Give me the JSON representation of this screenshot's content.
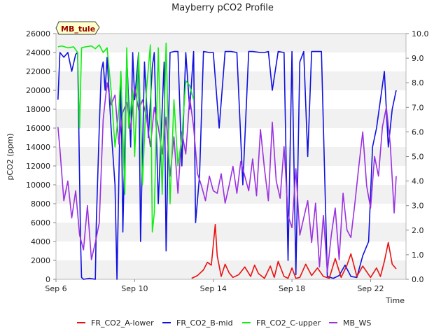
{
  "chart_data": {
    "type": "line",
    "title": "Mayberry pCO2 Profile",
    "xlabel": "Time",
    "ylabel": "pCO2 (ppm)",
    "ylim": [
      0,
      26000
    ],
    "y2lim": [
      0,
      10
    ],
    "xlim": [
      6,
      23.8
    ],
    "x_ticks": [
      6,
      10,
      14,
      18,
      22
    ],
    "x_tick_labels": [
      "Sep 6",
      "Sep 10",
      "Sep 14",
      "Sep 18",
      "Sep 22"
    ],
    "y_ticks": [
      0,
      2000,
      4000,
      6000,
      8000,
      10000,
      12000,
      14000,
      16000,
      18000,
      20000,
      22000,
      24000,
      26000
    ],
    "y2_ticks": [
      "0.0",
      "1.0",
      "2.0",
      "3.0",
      "4.0",
      "5.0",
      "6.0",
      "7.0",
      "8.0",
      "9.0",
      "10.0"
    ],
    "grid": "horizontal bands",
    "legend_position": "bottom",
    "annotation": "MB_tule",
    "series": [
      {
        "name": "FR_CO2_A-lower",
        "color": "#e81010",
        "axis": "left",
        "x": [
          12.9,
          13.2,
          13.5,
          13.7,
          13.9,
          14.1,
          14.2,
          14.4,
          14.6,
          14.8,
          15.0,
          15.3,
          15.6,
          15.9,
          16.1,
          16.3,
          16.6,
          16.9,
          17.1,
          17.3,
          17.6,
          17.8,
          18.0,
          18.2,
          18.4,
          18.7,
          19.0,
          19.3,
          19.6,
          19.9,
          20.2,
          20.5,
          20.8,
          21.0,
          21.3,
          21.6,
          21.8,
          22.0,
          22.3,
          22.5,
          22.7,
          22.9,
          23.1,
          23.3
        ],
        "y": [
          100,
          400,
          1000,
          1800,
          1500,
          5800,
          2500,
          300,
          1600,
          700,
          200,
          500,
          1300,
          300,
          1500,
          600,
          100,
          1400,
          200,
          1900,
          300,
          100,
          1200,
          100,
          200,
          1600,
          400,
          1200,
          300,
          100,
          2200,
          200,
          1500,
          2700,
          300,
          1400,
          800,
          200,
          1200,
          300,
          1900,
          3900,
          1600,
          1100
        ]
      },
      {
        "name": "FR_CO2_B-mid",
        "color": "#1010e0",
        "axis": "left",
        "x": [
          6.1,
          6.2,
          6.4,
          6.6,
          6.8,
          7.0,
          7.1,
          7.25,
          7.3,
          7.4,
          7.7,
          8.0,
          8.05,
          8.2,
          8.3,
          8.4,
          8.5,
          8.6,
          8.8,
          9.0,
          9.1,
          9.3,
          9.4,
          9.6,
          9.8,
          9.9,
          10.0,
          10.2,
          10.3,
          10.5,
          10.7,
          10.9,
          11.0,
          11.2,
          11.5,
          11.6,
          11.8,
          12.0,
          12.2,
          12.4,
          12.6,
          12.8,
          13.0,
          13.1,
          13.3,
          13.5,
          13.8,
          14.0,
          14.3,
          14.6,
          14.9,
          15.2,
          15.5,
          15.8,
          16.0,
          16.4,
          16.6,
          16.8,
          17.0,
          17.3,
          17.6,
          17.8,
          18.0,
          18.2,
          18.4,
          18.6,
          18.8,
          19.0,
          19.2,
          19.5,
          19.8,
          20.1,
          20.4,
          20.7,
          21.0,
          21.3,
          21.6,
          21.9,
          22.1,
          22.3,
          22.5,
          22.7,
          22.9,
          23.1,
          23.3
        ],
        "y": [
          19000,
          24000,
          23500,
          24000,
          22000,
          23800,
          24000,
          4000,
          200,
          0,
          100,
          0,
          6000,
          16000,
          22000,
          23000,
          20000,
          23500,
          16000,
          10000,
          0,
          22000,
          5000,
          23500,
          14000,
          24000,
          19000,
          24000,
          4000,
          23000,
          15000,
          22500,
          24000,
          8000,
          23000,
          3000,
          24000,
          24100,
          24100,
          12000,
          24000,
          18000,
          24100,
          6000,
          11000,
          24100,
          24000,
          24000,
          16000,
          24100,
          24100,
          24000,
          10000,
          24100,
          24100,
          24000,
          24000,
          24100,
          20000,
          24100,
          24000,
          2000,
          24100,
          500,
          23000,
          24100,
          13000,
          24100,
          24100,
          24100,
          300,
          100,
          400,
          1500,
          300,
          200,
          2500,
          4000,
          14000,
          16000,
          19000,
          22000,
          14000,
          18000,
          20000
        ]
      },
      {
        "name": "FR_CO2_C-upper",
        "color": "#11ee11",
        "axis": "left",
        "x": [
          6.1,
          6.3,
          6.6,
          6.9,
          7.1,
          7.2,
          7.3,
          7.5,
          7.8,
          8.0,
          8.2,
          8.4,
          8.6,
          8.8,
          9.0,
          9.2,
          9.3,
          9.5,
          9.6,
          9.7,
          9.9,
          10.0,
          10.2,
          10.4,
          10.6,
          10.8,
          10.9,
          11.0,
          11.2,
          11.4,
          11.6,
          11.8,
          12.0,
          12.2,
          12.4,
          12.6,
          12.8,
          13.0
        ],
        "y": [
          24600,
          24700,
          24500,
          24600,
          24000,
          16000,
          24500,
          24600,
          24700,
          24400,
          24800,
          24000,
          24500,
          20000,
          14000,
          18000,
          22000,
          9000,
          24500,
          16000,
          20000,
          13000,
          24000,
          10000,
          20000,
          24800,
          5000,
          7000,
          24500,
          9000,
          25000,
          8000,
          19000,
          12000,
          15000,
          21000,
          20500,
          19000
        ]
      },
      {
        "name": "MB_WS",
        "color": "#9b30e0",
        "axis": "right",
        "x": [
          6.1,
          6.2,
          6.4,
          6.6,
          6.8,
          7.0,
          7.2,
          7.4,
          7.6,
          7.8,
          8.0,
          8.2,
          8.4,
          8.6,
          8.8,
          9.0,
          9.2,
          9.4,
          9.6,
          9.8,
          10.0,
          10.2,
          10.4,
          10.6,
          10.8,
          11.0,
          11.2,
          11.4,
          11.6,
          11.8,
          12.0,
          12.2,
          12.4,
          12.6,
          12.8,
          13.0,
          13.2,
          13.4,
          13.6,
          13.8,
          14.0,
          14.2,
          14.4,
          14.6,
          14.8,
          15.0,
          15.2,
          15.4,
          15.6,
          15.8,
          16.0,
          16.2,
          16.4,
          16.6,
          16.8,
          17.0,
          17.2,
          17.4,
          17.6,
          17.8,
          18.0,
          18.2,
          18.4,
          18.6,
          18.8,
          19.0,
          19.2,
          19.4,
          19.6,
          19.8,
          20.0,
          20.2,
          20.4,
          20.6,
          20.8,
          21.0,
          21.2,
          21.4,
          21.6,
          21.8,
          22.0,
          22.2,
          22.4,
          22.6,
          22.8,
          23.0,
          23.2,
          23.3
        ],
        "y": [
          6.2,
          5.3,
          3.2,
          4.0,
          2.5,
          3.6,
          1.8,
          1.2,
          3.0,
          0.8,
          1.5,
          2.3,
          6.5,
          8.0,
          7.1,
          7.5,
          5.5,
          6.8,
          7.2,
          6.1,
          7.8,
          6.9,
          7.3,
          6.6,
          5.4,
          7.0,
          6.2,
          5.1,
          6.6,
          4.2,
          5.8,
          3.5,
          6.0,
          5.1,
          7.4,
          6.2,
          4.3,
          3.8,
          3.2,
          4.2,
          3.6,
          3.5,
          4.3,
          3.1,
          3.8,
          4.6,
          3.5,
          4.8,
          4.2,
          3.6,
          4.9,
          3.4,
          6.1,
          4.5,
          3.2,
          6.4,
          4.0,
          3.3,
          5.4,
          2.6,
          2.1,
          4.5,
          1.8,
          2.5,
          3.2,
          1.5,
          3.1,
          0.5,
          2.6,
          0.3,
          1.8,
          2.9,
          0.8,
          3.5,
          2.0,
          1.7,
          3.1,
          4.6,
          6.0,
          3.8,
          2.9,
          5.0,
          4.2,
          6.2,
          7.0,
          5.5,
          2.7,
          4.2
        ]
      }
    ]
  }
}
